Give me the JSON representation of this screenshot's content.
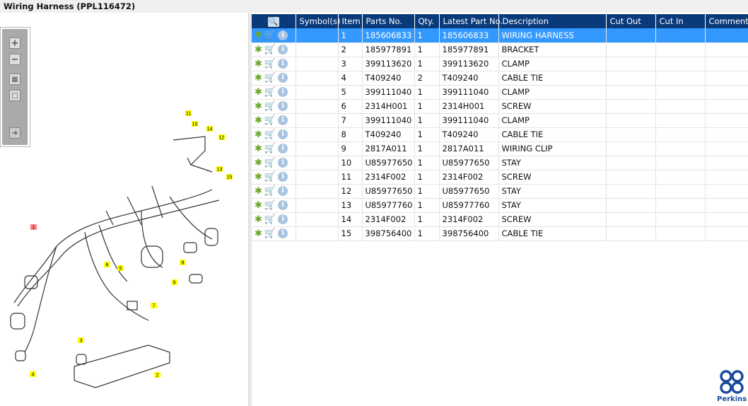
{
  "title": "Wiring Harness (PPL116472)",
  "toolbar": {
    "zoom_in": "+",
    "zoom_out": "−"
  },
  "columns": [
    "",
    "Symbol(s)",
    "Item",
    "Parts No.",
    "Qty.",
    "Latest Part No.",
    "Description",
    "Cut Out",
    "Cut In",
    "Comment"
  ],
  "rows": [
    {
      "item": "1",
      "part": "185606833",
      "qty": "1",
      "latest": "185606833",
      "desc": "WIRING HARNESS"
    },
    {
      "item": "2",
      "part": "185977891",
      "qty": "1",
      "latest": "185977891",
      "desc": "BRACKET"
    },
    {
      "item": "3",
      "part": "399113620",
      "qty": "1",
      "latest": "399113620",
      "desc": "CLAMP"
    },
    {
      "item": "4",
      "part": "T409240",
      "qty": "2",
      "latest": "T409240",
      "desc": "CABLE TIE"
    },
    {
      "item": "5",
      "part": "399111040",
      "qty": "1",
      "latest": "399111040",
      "desc": "CLAMP"
    },
    {
      "item": "6",
      "part": "2314H001",
      "qty": "1",
      "latest": "2314H001",
      "desc": "SCREW"
    },
    {
      "item": "7",
      "part": "399111040",
      "qty": "1",
      "latest": "399111040",
      "desc": "CLAMP"
    },
    {
      "item": "8",
      "part": "T409240",
      "qty": "1",
      "latest": "T409240",
      "desc": "CABLE TIE"
    },
    {
      "item": "9",
      "part": "2817A011",
      "qty": "1",
      "latest": "2817A011",
      "desc": "WIRING CLIP"
    },
    {
      "item": "10",
      "part": "U85977650",
      "qty": "1",
      "latest": "U85977650",
      "desc": "STAY"
    },
    {
      "item": "11",
      "part": "2314F002",
      "qty": "1",
      "latest": "2314F002",
      "desc": "SCREW"
    },
    {
      "item": "12",
      "part": "U85977650",
      "qty": "1",
      "latest": "U85977650",
      "desc": "STAY"
    },
    {
      "item": "13",
      "part": "U85977760",
      "qty": "1",
      "latest": "U85977760",
      "desc": "STAY"
    },
    {
      "item": "14",
      "part": "2314F002",
      "qty": "1",
      "latest": "2314F002",
      "desc": "SCREW"
    },
    {
      "item": "15",
      "part": "398756400",
      "qty": "1",
      "latest": "398756400",
      "desc": "CABLE TIE"
    }
  ],
  "selected_item": "1",
  "callouts": [
    "11",
    "10",
    "14",
    "12",
    "13",
    "15",
    "1",
    "8",
    "6",
    "5",
    "9",
    "7",
    "3",
    "4",
    "2"
  ],
  "logo": "Perkins",
  "colors": {
    "header": "#0a3a7a",
    "selected": "#3399ff",
    "callout": "#ffff00"
  }
}
